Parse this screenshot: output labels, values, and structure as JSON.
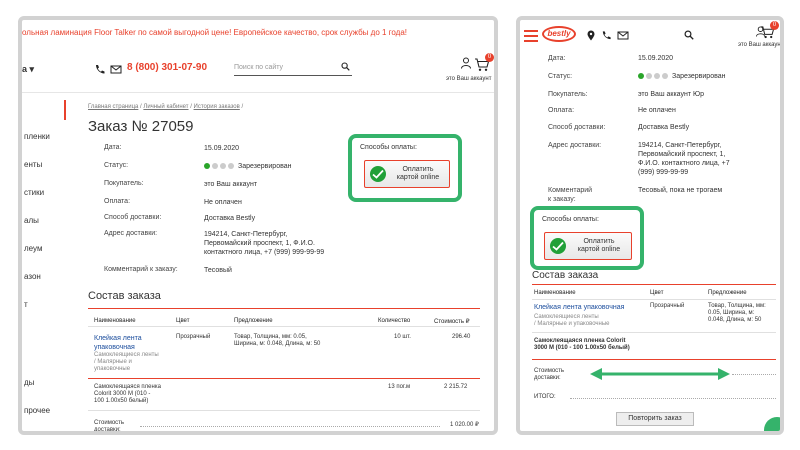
{
  "left": {
    "promo": "ольная ламинация Floor Talker по самой выгодной цене! Европейское качество, срок службы до 1 года!",
    "city": "а",
    "phone": "8 (800) 301-07-90",
    "search_placeholder": "Поиск по сайту",
    "account_label": "это Ваш аккаунт",
    "cart_count": "0",
    "sidebar": [
      "пленки",
      "енты",
      "стики",
      "алы",
      "леум",
      "азон",
      "т",
      "ды",
      "прочее"
    ],
    "breadcrumb": {
      "home": "Главная страница",
      "cabinet": "Личный кабинет",
      "history": "История заказов"
    },
    "title": "Заказ № 27059",
    "fields": {
      "date_label": "Дата:",
      "date": "15.09.2020",
      "status_label": "Статус:",
      "status": "Зарезервирован",
      "buyer_label": "Покупатель:",
      "buyer": "это Ваш аккаунт",
      "payment_label": "Оплата:",
      "payment": "Не оплачен",
      "delivery_label": "Способ доставки:",
      "delivery": "Доставка Bestly",
      "address_label": "Адрес доставки:",
      "address": [
        "194214, Санкт-Петербург,",
        "Первомайский проспект, 1, Ф.И.О.",
        "контактного лица, +7 (999) 999-99-99"
      ],
      "comment_label": "Комментарий к заказу:",
      "comment": "Тесовый"
    },
    "pay_title": "Способы оплаты:",
    "pay_button": [
      "Оплатить",
      "картой online"
    ],
    "section_title": "Состав заказа",
    "columns": {
      "name": "Наименование",
      "color": "Цвет",
      "offer": "Предложение",
      "qty": "Количество",
      "cost": "Стоимость ₽"
    },
    "rows": [
      {
        "name": [
          "Клейкая лента",
          "упаковочная"
        ],
        "sub": [
          "Самоклеящиеся ленты",
          "/ Малярные и",
          "упаковочные"
        ],
        "color": "Прозрачный",
        "offer": [
          "Товар, Толщина, мм: 0.05,",
          "Ширина, м: 0.048, Длина, м: 50"
        ],
        "qty": "10 шт.",
        "cost": "296.40"
      },
      {
        "name": [
          "Самоклеящаяся пленка",
          "Colorit 3000 M (010 -",
          "100 1.00x50 белый)"
        ],
        "qty": "13 пог.м",
        "cost": "2 215.72"
      }
    ],
    "footer_label": [
      "Стоимость",
      "доставки:"
    ],
    "footer_value": "1 020.00 ₽"
  },
  "right": {
    "logo": "bestly",
    "account_label": "это Ваш аккаунт",
    "cart_count": "0",
    "fields": {
      "date_label": "Дата:",
      "date": "15.09.2020",
      "status_label": "Статус:",
      "status": "Зарезервирован",
      "buyer_label": "Покупатель:",
      "buyer": "это Ваш аккаунт Юр",
      "payment_label": "Оплата:",
      "payment": "Не оплачен",
      "delivery_label": "Способ доставки:",
      "delivery": "Доставка Bestly",
      "address_label": "Адрес доставки:",
      "address": [
        "194214, Санкт-Петербург,",
        "Первомайский проспект, 1,",
        "Ф.И.О. контактного лица, +7",
        "(999) 999-99-99"
      ],
      "comment_label": [
        "Комментарий",
        "к заказу:"
      ],
      "comment": "Тесовый, пока не трогаем"
    },
    "pay_title": "Способы оплаты:",
    "pay_button": [
      "Оплатить",
      "картой online"
    ],
    "section_title": "Состав заказа",
    "columns": {
      "name": "Наименование",
      "color": "Цвет",
      "offer": "Предложение"
    },
    "row1": {
      "name": "Клейкая лента упаковочная",
      "sub": [
        "Самоклеящиеся ленты",
        "/ Малярные и упаковочные"
      ],
      "color": "Прозрачный",
      "offer": [
        "Товар, Толщина, мм:",
        "0.05, Ширина, м:",
        "0.048, Длина, м: 50"
      ]
    },
    "row2": [
      "Самоклеящаяся пленка Colorit",
      "3000 M (010 - 100 1.00x50 белый)"
    ],
    "footer_label": [
      "Стоимость",
      "доставки:"
    ],
    "total_label": "ИТОГО:",
    "repeat_button": "Повторить заказ"
  }
}
